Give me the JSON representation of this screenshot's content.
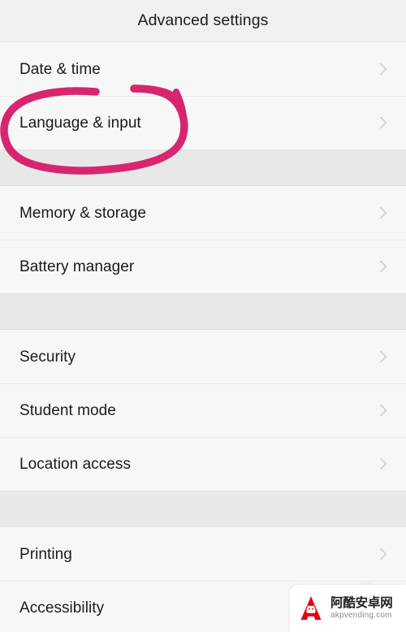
{
  "header": {
    "title": "Advanced settings"
  },
  "list": {
    "chevron_icon": "chevron-right-icon",
    "groups": [
      {
        "id": "group-1",
        "items": [
          {
            "label": "Date & time",
            "name": "date-and-time"
          },
          {
            "label": "Language & input",
            "name": "language-and-input",
            "highlighted": true
          }
        ]
      },
      {
        "id": "group-2",
        "items": [
          {
            "label": "Memory & storage",
            "name": "memory-and-storage"
          },
          {
            "label": "Battery manager",
            "name": "battery-manager"
          }
        ]
      },
      {
        "id": "group-3",
        "items": [
          {
            "label": "Security",
            "name": "security"
          },
          {
            "label": "Student mode",
            "name": "student-mode"
          },
          {
            "label": "Location access",
            "name": "location-access"
          }
        ]
      },
      {
        "id": "group-4",
        "items": [
          {
            "label": "Printing",
            "name": "printing"
          },
          {
            "label": "Accessibility",
            "name": "accessibility"
          }
        ]
      }
    ]
  },
  "annotation": {
    "type": "hand-drawn-ellipse",
    "target": "Language & input",
    "color": "#d8256f"
  },
  "watermark": {
    "logo_icon": "android-robot-a-logo-icon",
    "site_name_cn": "阿酷安卓网",
    "url": "akpvending.com",
    "logo_color": "#e60012"
  },
  "colors": {
    "header_background": "#f0f0f0",
    "row_background": "#f7f7f7",
    "group_gap_background": "#e8e8e8",
    "separator": "#eceaea",
    "text_primary": "#1a1a1a",
    "chevron": "#bdbdbd",
    "annotation_pink": "#d8256f"
  }
}
